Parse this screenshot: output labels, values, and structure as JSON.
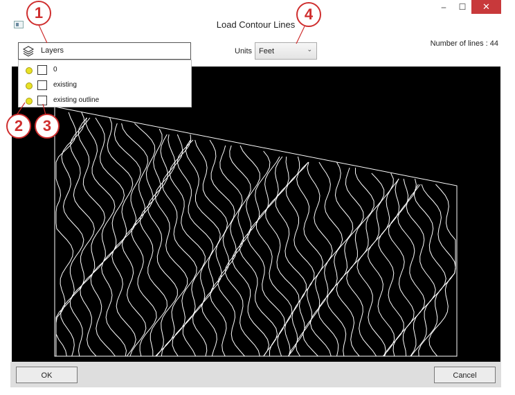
{
  "window": {
    "title": "Load Contour Lines",
    "minimize": "–",
    "maximize": "☐",
    "close": "✕"
  },
  "layers": {
    "label": "Layers",
    "items": [
      {
        "name": "0"
      },
      {
        "name": "existing"
      },
      {
        "name": "existing outline"
      }
    ]
  },
  "units": {
    "label": "Units",
    "selected": "Feet",
    "chevron": "⌄"
  },
  "status": {
    "line_count": "Number of lines : 44"
  },
  "buttons": {
    "ok": "OK",
    "cancel": "Cancel"
  },
  "callouts": [
    "1",
    "2",
    "3",
    "4"
  ],
  "colors": {
    "callout": "#cf2e2e",
    "layer_dot": "#e8e226",
    "canvas": "#000000",
    "contour": "#ffffff"
  }
}
